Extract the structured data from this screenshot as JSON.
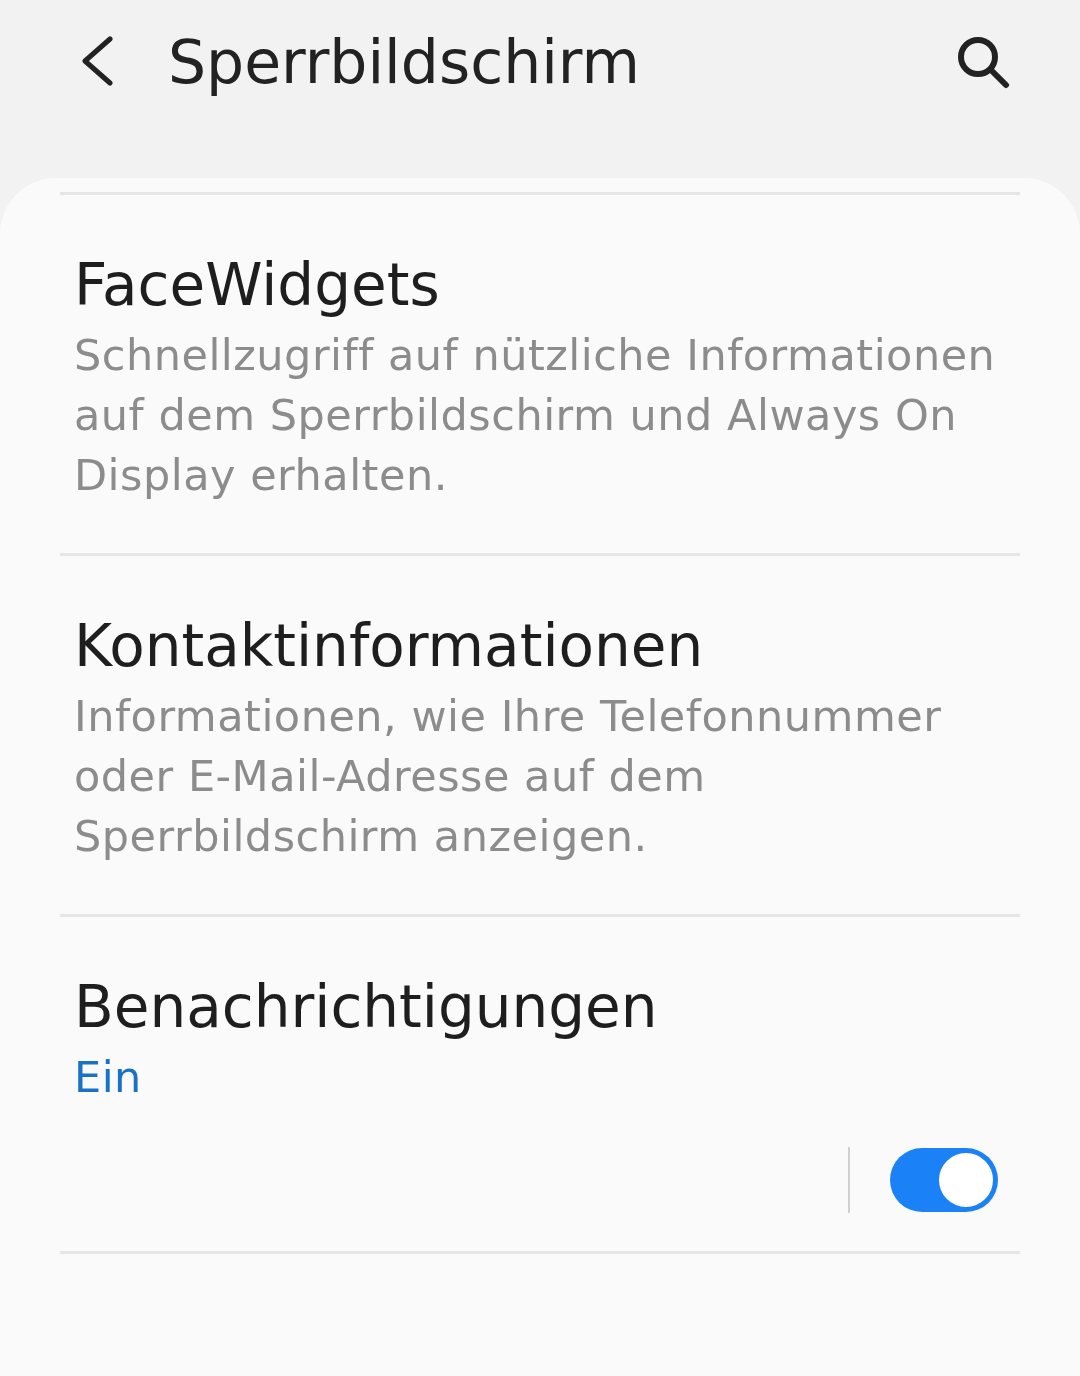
{
  "header": {
    "title": "Sperrbildschirm"
  },
  "items": [
    {
      "kind": "text",
      "title": "FaceWidgets",
      "summary": "Schnellzugriff auf nützliche Informationen auf dem Sperrbildschirm und Always On Display erhalten."
    },
    {
      "kind": "text",
      "title": "Kontaktinformationen",
      "summary": "Informationen, wie Ihre Telefonnummer oder E-Mail-Adresse auf dem Sperrbildschirm anzeigen."
    },
    {
      "kind": "switch",
      "title": "Benachrichtigungen",
      "summary": "Ein",
      "on": true
    }
  ]
}
